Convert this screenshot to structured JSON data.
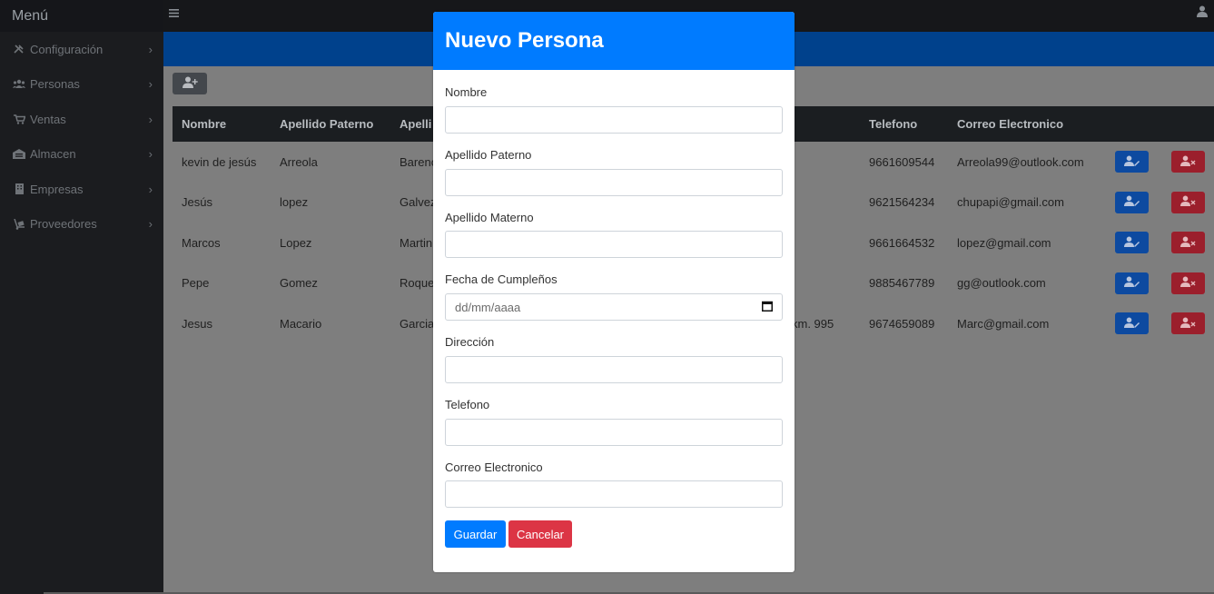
{
  "sidebar": {
    "title": "Menú",
    "items": [
      {
        "label": "Configuración",
        "icon": "tools-icon"
      },
      {
        "label": "Personas",
        "icon": "users-icon"
      },
      {
        "label": "Ventas",
        "icon": "cart-icon"
      },
      {
        "label": "Almacen",
        "icon": "warehouse-icon"
      },
      {
        "label": "Empresas",
        "icon": "building-icon"
      },
      {
        "label": "Proveedores",
        "icon": "dolly-icon"
      }
    ]
  },
  "table": {
    "headers": [
      "Nombre",
      "Apellido Paterno",
      "Apelli",
      "",
      "Telefono",
      "Correo Electronico"
    ],
    "rows": [
      {
        "nombre": "kevin de jesús",
        "paterno": "Arreola",
        "materno": "Barenc",
        "direccion": "",
        "telefono": "9661609544",
        "correo": "Arreola99@outlook.com"
      },
      {
        "nombre": "Jesús",
        "paterno": "lopez",
        "materno": "Galvez",
        "direccion": "",
        "telefono": "9621564234",
        "correo": "chupapi@gmail.com"
      },
      {
        "nombre": "Marcos",
        "paterno": "Lopez",
        "materno": "Martin",
        "direccion": "",
        "telefono": "9661664532",
        "correo": "lopez@gmail.com"
      },
      {
        "nombre": "Pepe",
        "paterno": "Gomez",
        "materno": "Roque",
        "direccion": "",
        "telefono": "9885467789",
        "correo": "gg@outlook.com"
      },
      {
        "nombre": "Jesus",
        "paterno": "Macario",
        "materno": "Garcia",
        "direccion": "km. 995",
        "telefono": "9674659089",
        "correo": "Marc@gmail.com"
      }
    ]
  },
  "modal": {
    "title": "Nuevo Persona",
    "fields": [
      {
        "label": "Nombre",
        "value": ""
      },
      {
        "label": "Apellido Paterno",
        "value": ""
      },
      {
        "label": "Apellido Materno",
        "value": ""
      },
      {
        "label": "Fecha de Cumpleños",
        "value": "dd/mm/aaaa"
      },
      {
        "label": "Dirección",
        "value": ""
      },
      {
        "label": "Telefono",
        "value": ""
      },
      {
        "label": "Correo Electronico",
        "value": ""
      }
    ],
    "save_label": "Guardar",
    "cancel_label": "Cancelar"
  },
  "colors": {
    "primary": "#007bff",
    "danger": "#dc3545",
    "sidebar": "#1b1c1f",
    "header_bar": "#00418c"
  }
}
